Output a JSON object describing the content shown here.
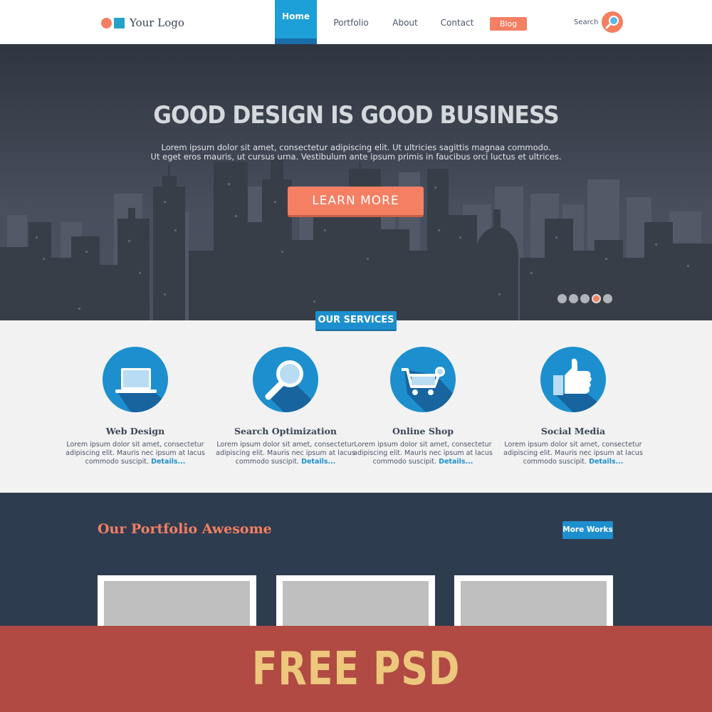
{
  "header": {
    "logo_text": "Your Logo",
    "nav": {
      "home": "Home",
      "portfolio": "Portfolio",
      "about": "About",
      "contact": "Contact",
      "blog": "Blog"
    },
    "search_label": "Search"
  },
  "hero": {
    "title": "GOOD DESIGN IS GOOD BUSINESS",
    "text_line1": "Lorem ipsum dolor sit amet, consectetur adipiscing elit. Ut ultricies sagittis magnaa commodo.",
    "text_line2": "Ut eget eros mauris, ut cursus urna. Vestibulum ante ipsum primis in faucibus orci luctus et ultrices.",
    "button_label": "LEARN MORE",
    "slider_dots": 5,
    "active_dot": 4
  },
  "services": {
    "tag": "OUR SERVICES",
    "items": [
      {
        "title": "Web Design",
        "text": "Lorem ipsum dolor sit amet, consectetur adipiscing elit. Mauris nec ipsum at lacus commodo suscipit.",
        "link": "Details...",
        "icon": "laptop-icon"
      },
      {
        "title": "Search Optimization",
        "text": "Lorem ipsum dolor sit amet, consectetur adipiscing elit. Mauris nec ipsum at lacus commodo suscipit.",
        "link": "Details...",
        "icon": "magnifier-icon"
      },
      {
        "title": "Online Shop",
        "text": "Lorem ipsum dolor sit amet, consectetur adipiscing elit. Mauris nec ipsum at lacus commodo suscipit.",
        "link": "Details...",
        "icon": "shopping-cart-icon"
      },
      {
        "title": "Social Media",
        "text": "Lorem ipsum dolor sit amet, consectetur adipiscing elit. Mauris nec ipsum at lacus commodo suscipit.",
        "link": "Details...",
        "icon": "thumbs-up-icon"
      }
    ]
  },
  "portfolio": {
    "title": "Our Portfolio Awesome",
    "more_works": "More Works"
  },
  "banner": {
    "text": "FREE PSD"
  },
  "colors": {
    "accent_orange": "#f47f63",
    "accent_blue": "#1d8fce",
    "dark_navy": "#2e3c4f",
    "banner_red": "#b04a43",
    "banner_text": "#ecc77c"
  }
}
